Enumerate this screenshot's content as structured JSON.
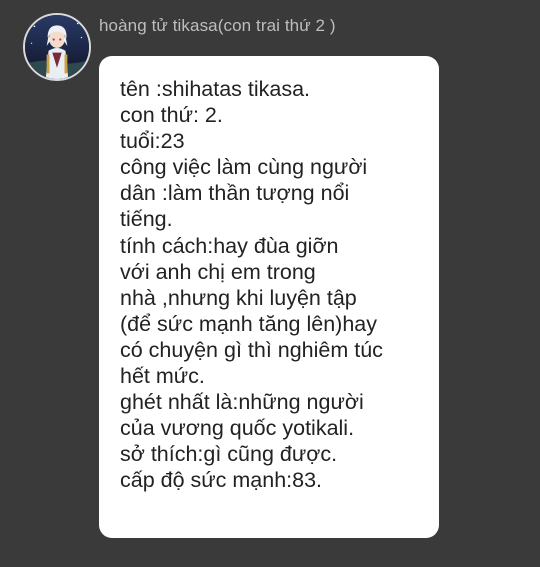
{
  "message": {
    "sender_name": "hoàng tử tikasa(con trai thứ 2 )",
    "avatar_icon": "character-portrait-avatar",
    "bubble_color": "#ffffff",
    "background_color": "#3a3a3a",
    "lines": [
      "tên :shihatas tikasa.",
      "con thứ: 2.",
      "tuổi:23",
      "công việc làm cùng người",
      "dân :làm thần tượng nổi",
      "tiếng.",
      "tính cách:hay đùa giỡn",
      "với anh chị em trong",
      "nhà ,nhưng khi luyện tập",
      "(để sức mạnh tăng lên)hay",
      "có chuyện gì thì nghiêm túc",
      "hết mức.",
      "ghét nhất là:những người",
      "của vương quốc yotikali.",
      "sở thích:gì cũng được.",
      "cấp độ sức mạnh:83."
    ]
  }
}
